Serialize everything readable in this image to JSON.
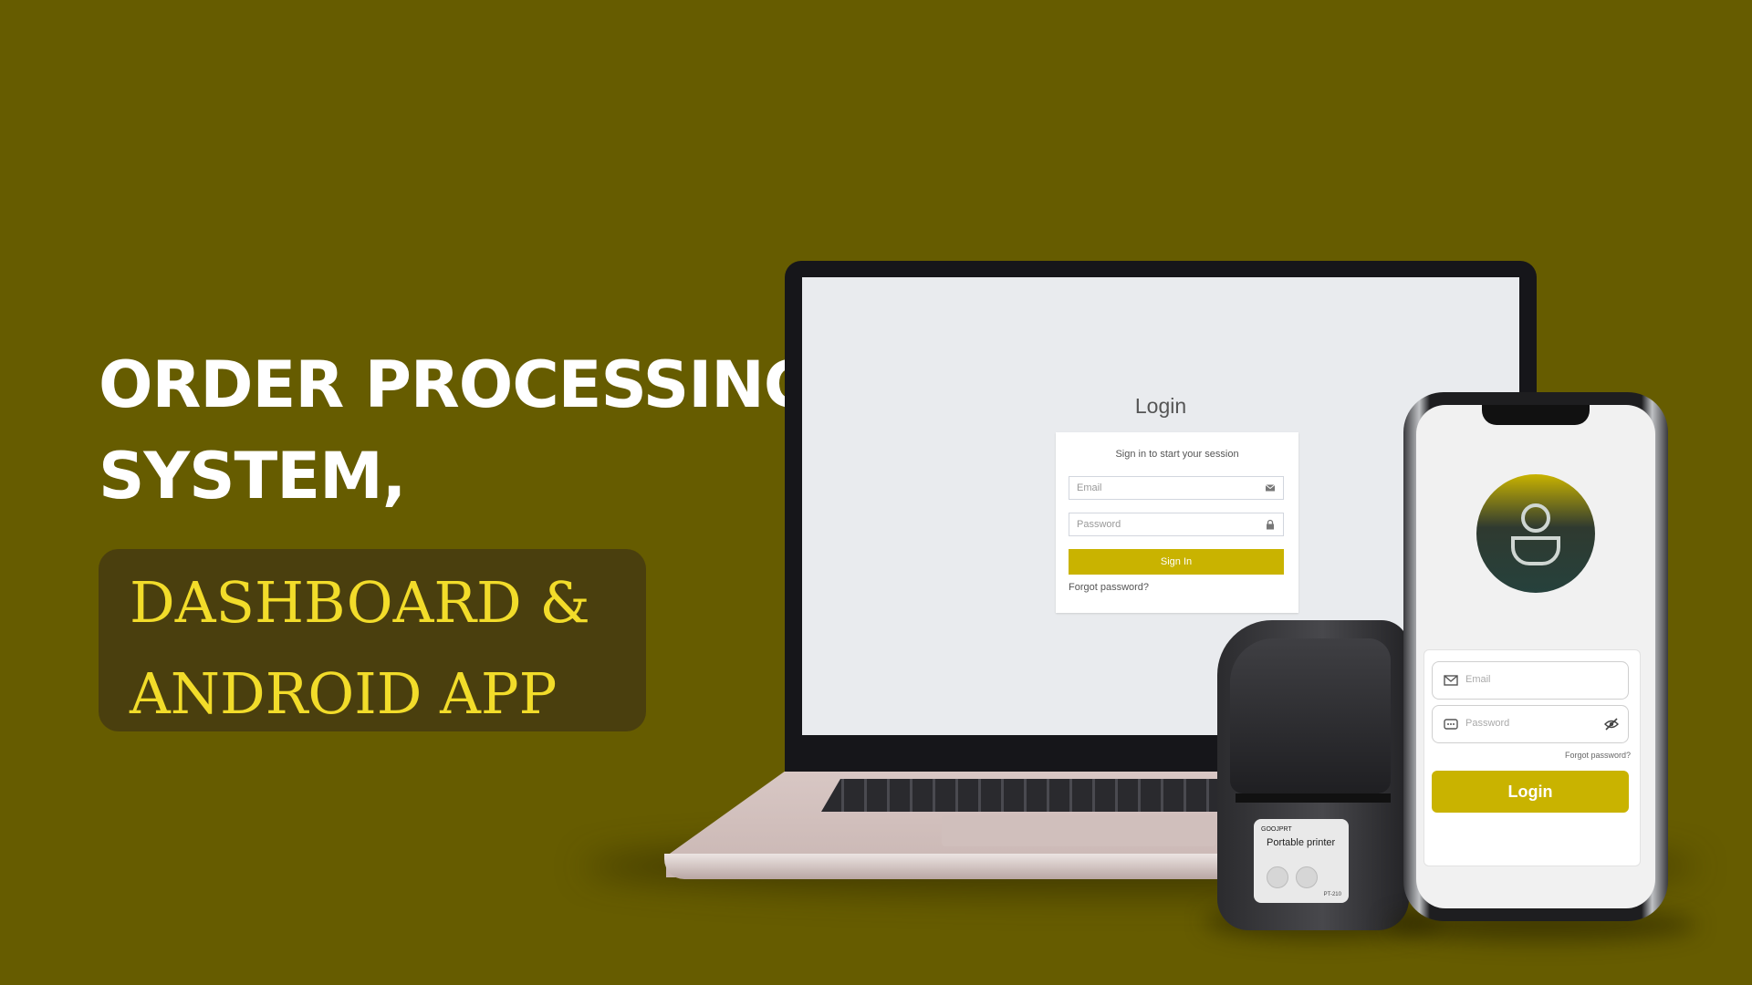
{
  "headline": {
    "line1": "ORDER PROCESSING",
    "line2": "SYSTEM,"
  },
  "subheadline": {
    "line1": "DASHBOARD &",
    "line2": "ANDROID APP"
  },
  "web_login": {
    "title": "Login",
    "subtitle": "Sign in to start your session",
    "email_placeholder": "Email",
    "password_placeholder": "Password",
    "sign_in_label": "Sign In",
    "forgot_label": "Forgot password?"
  },
  "printer": {
    "brand": "GOOJPRT",
    "label": "Portable printer",
    "model": "PT-210"
  },
  "mobile_login": {
    "email_placeholder": "Email",
    "password_placeholder": "Password",
    "forgot_label": "Forgot password?",
    "login_label": "Login"
  },
  "icons": {
    "email": "envelope-icon",
    "password": "lock-icon",
    "password_mobile": "keypad-icon",
    "visibility": "eye-off-icon",
    "avatar": "user-icon"
  },
  "colors": {
    "background": "#665c00",
    "accent": "#c9b300",
    "subheadline_text": "#f2dc2a",
    "subheadline_box": "#4a3f0e"
  }
}
